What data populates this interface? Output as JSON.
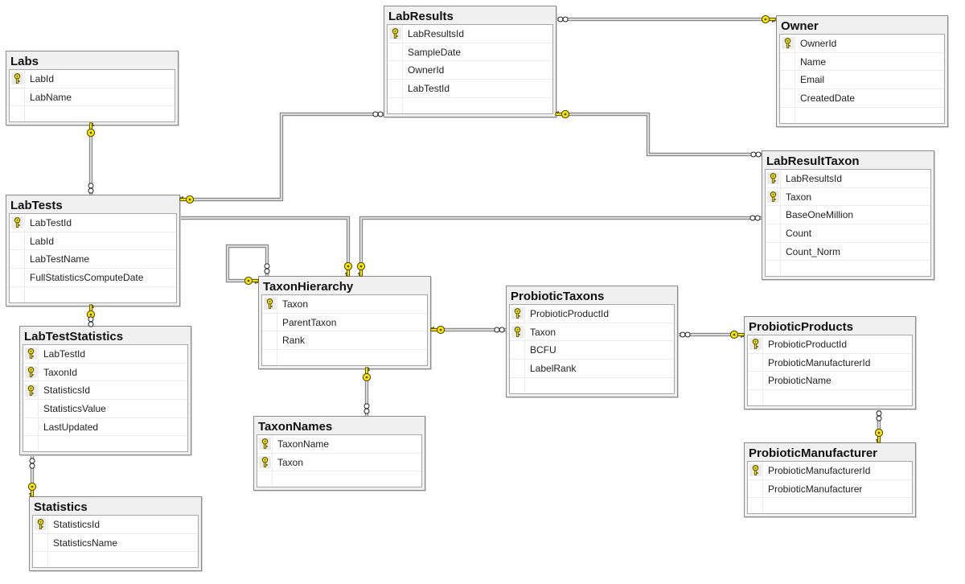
{
  "tables": [
    {
      "name": "Labs",
      "columns": [
        {
          "name": "LabId",
          "pk": true
        },
        {
          "name": "LabName",
          "pk": false
        }
      ]
    },
    {
      "name": "LabResults",
      "columns": [
        {
          "name": "LabResultsId",
          "pk": true
        },
        {
          "name": "SampleDate",
          "pk": false
        },
        {
          "name": "OwnerId",
          "pk": false
        },
        {
          "name": "LabTestId",
          "pk": false
        }
      ]
    },
    {
      "name": "Owner",
      "columns": [
        {
          "name": "OwnerId",
          "pk": true
        },
        {
          "name": "Name",
          "pk": false
        },
        {
          "name": "Email",
          "pk": false
        },
        {
          "name": "CreatedDate",
          "pk": false
        }
      ]
    },
    {
      "name": "LabResultTaxon",
      "columns": [
        {
          "name": "LabResultsId",
          "pk": true
        },
        {
          "name": "Taxon",
          "pk": true
        },
        {
          "name": "BaseOneMillion",
          "pk": false
        },
        {
          "name": "Count",
          "pk": false
        },
        {
          "name": "Count_Norm",
          "pk": false
        }
      ]
    },
    {
      "name": "LabTests",
      "columns": [
        {
          "name": "LabTestId",
          "pk": true
        },
        {
          "name": "LabId",
          "pk": false
        },
        {
          "name": "LabTestName",
          "pk": false
        },
        {
          "name": "FullStatisticsComputeDate",
          "pk": false
        }
      ]
    },
    {
      "name": "LabTestStatistics",
      "columns": [
        {
          "name": "LabTestId",
          "pk": true
        },
        {
          "name": "TaxonId",
          "pk": true
        },
        {
          "name": "StatisticsId",
          "pk": true
        },
        {
          "name": "StatisticsValue",
          "pk": false
        },
        {
          "name": "LastUpdated",
          "pk": false
        }
      ]
    },
    {
      "name": "Statistics",
      "columns": [
        {
          "name": "StatisticsId",
          "pk": true
        },
        {
          "name": "StatisticsName",
          "pk": false
        }
      ]
    },
    {
      "name": "TaxonHierarchy",
      "columns": [
        {
          "name": "Taxon",
          "pk": true
        },
        {
          "name": "ParentTaxon",
          "pk": false
        },
        {
          "name": "Rank",
          "pk": false
        }
      ]
    },
    {
      "name": "TaxonNames",
      "columns": [
        {
          "name": "TaxonName",
          "pk": true
        },
        {
          "name": "Taxon",
          "pk": true
        }
      ]
    },
    {
      "name": "ProbioticTaxons",
      "columns": [
        {
          "name": "ProbioticProductId",
          "pk": true
        },
        {
          "name": "Taxon",
          "pk": true
        },
        {
          "name": "BCFU",
          "pk": false
        },
        {
          "name": "LabelRank",
          "pk": false
        }
      ]
    },
    {
      "name": "ProbioticProducts",
      "columns": [
        {
          "name": "ProbioticProductId",
          "pk": true
        },
        {
          "name": "ProbioticManufacturerId",
          "pk": false
        },
        {
          "name": "ProbioticName",
          "pk": false
        }
      ]
    },
    {
      "name": "ProbioticManufacturer",
      "columns": [
        {
          "name": "ProbioticManufacturerId",
          "pk": true
        },
        {
          "name": "ProbioticManufacturer",
          "pk": false
        }
      ]
    }
  ],
  "relationships": [
    {
      "many": "LabResults",
      "one": "Owner"
    },
    {
      "many": "LabResults",
      "one": "LabTests"
    },
    {
      "many": "LabResultTaxon",
      "one": "LabResults"
    },
    {
      "many": "LabTests",
      "one": "Labs"
    },
    {
      "many": "LabTests",
      "one": "TaxonHierarchy"
    },
    {
      "many": "LabResultTaxon",
      "one": "TaxonHierarchy"
    },
    {
      "many": "TaxonHierarchy",
      "one": "TaxonHierarchy"
    },
    {
      "many": "ProbioticTaxons",
      "one": "TaxonHierarchy"
    },
    {
      "many": "TaxonNames",
      "one": "TaxonHierarchy"
    },
    {
      "many": "ProbioticTaxons",
      "one": "ProbioticProducts"
    },
    {
      "many": "ProbioticProducts",
      "one": "ProbioticManufacturer"
    },
    {
      "many": "LabTestStatistics",
      "one": "LabTests"
    },
    {
      "many": "LabTestStatistics",
      "one": "Statistics"
    }
  ],
  "icons": {
    "primary_key": "key-icon",
    "one_end": "key-icon",
    "many_end": "infinity-icon"
  },
  "colors": {
    "key_yellow": "#f4e400",
    "key_outline": "#4a4200",
    "connector_outer": "#8c8c8c",
    "connector_inner": "#e4e4e4",
    "table_header_bg": "#f0f0f0",
    "table_border": "#8a8a8a"
  }
}
